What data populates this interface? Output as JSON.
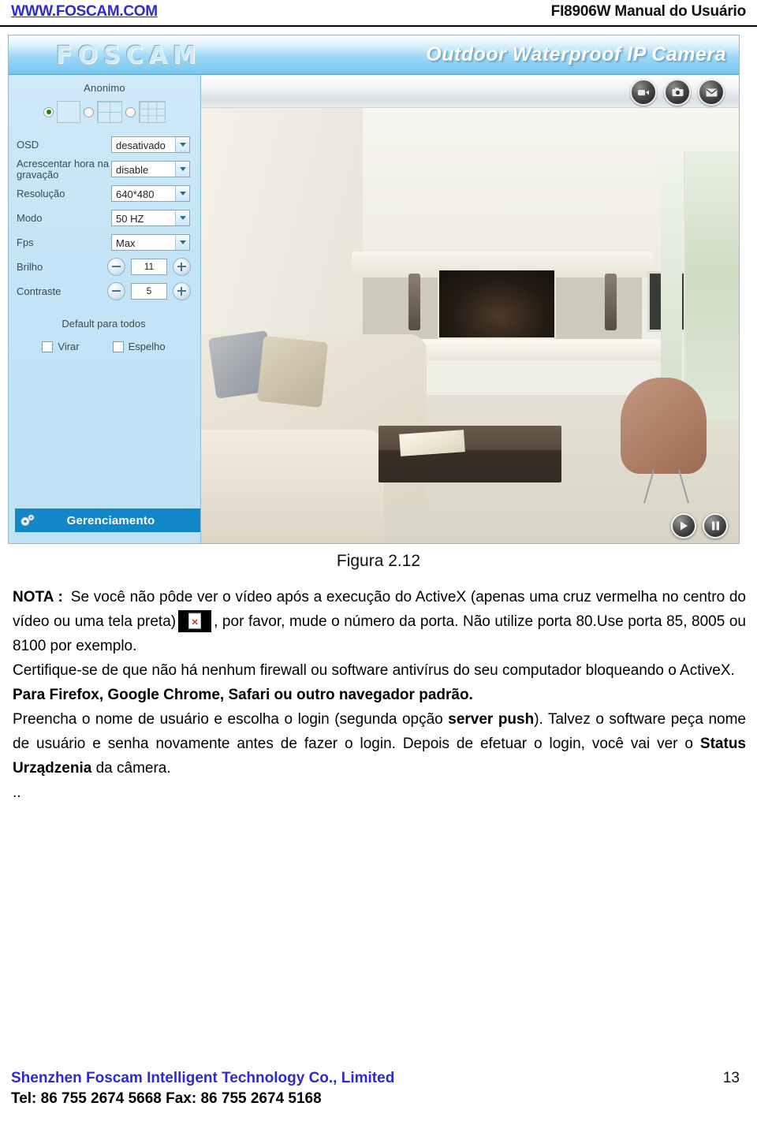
{
  "header": {
    "site": "WWW.FOSCAM.COM",
    "manual_title": "FI8906W Manual do Usuário"
  },
  "screenshot": {
    "brand": "FOSCAM",
    "product_title": "Outdoor Waterproof IP Camera",
    "toolbar_icons": [
      "video-icon",
      "snapshot-icon",
      "mail-icon"
    ],
    "sidebar": {
      "user_label": "Anonimo",
      "layout_options": [
        {
          "name": "single-view",
          "selected": true
        },
        {
          "name": "quad-view",
          "selected": false
        },
        {
          "name": "nine-view",
          "selected": false
        }
      ],
      "settings": [
        {
          "label": "OSD",
          "type": "select",
          "value": "desativado"
        },
        {
          "label": "Acrescentar hora na gravação",
          "type": "select",
          "value": "disable"
        },
        {
          "label": "Resolução",
          "type": "select",
          "value": "640*480"
        },
        {
          "label": "Modo",
          "type": "select",
          "value": "50 HZ"
        },
        {
          "label": "Fps",
          "type": "select",
          "value": "Max"
        },
        {
          "label": "Brilho",
          "type": "spinner",
          "value": "11"
        },
        {
          "label": "Contraste",
          "type": "spinner",
          "value": "5"
        }
      ],
      "default_all": "Default para todos",
      "checkboxes": [
        {
          "label": "Virar",
          "checked": false
        },
        {
          "label": "Espelho",
          "checked": false
        }
      ],
      "management_label": "Gerenciamento"
    },
    "player": {
      "play": "play-icon",
      "pause": "pause-icon"
    }
  },
  "figure": {
    "caption": "Figura 2.12"
  },
  "note": {
    "label": "NOTA :",
    "line1_before_icon": "Se você não pôde ver o vídeo após a execução do ActiveX (apenas uma cruz vermelha no centro do vídeo ou uma tela preta)",
    "line1_after_icon": ", por favor, mude o número da porta. Não utilize porta 80.Use porta 85, 8005 ou 8100 por exemplo.",
    "paragraph2": "Certifique-se de que não há nenhum firewall ou software antivírus do seu computador bloqueando o ActiveX.",
    "paragraph3_bold": "Para Firefox, Google Chrome, Safari ou outro navegador padrão.",
    "paragraph4_part1": "Preencha o nome de usuário e escolha o login (segunda opção ",
    "paragraph4_bold1": "server push",
    "paragraph4_part2": "). Talvez o software peça nome de usuário e senha novamente antes de fazer o login. Depois de efetuar o login, você vai ver o ",
    "paragraph4_bold2": "Status Urządzenia",
    "paragraph4_part3": " da câmera.",
    "trailing": ".."
  },
  "footer": {
    "company": "Shenzhen Foscam Intelligent Technology Co., Limited",
    "contact": "Tel: 86 755 2674 5668 Fax: 86 755 2674 5168",
    "page_number": "13"
  },
  "colors": {
    "link_blue": "#2b2bd4",
    "panel_blue": "#1287c8",
    "sidebar_bg": "#c3e4f6"
  }
}
